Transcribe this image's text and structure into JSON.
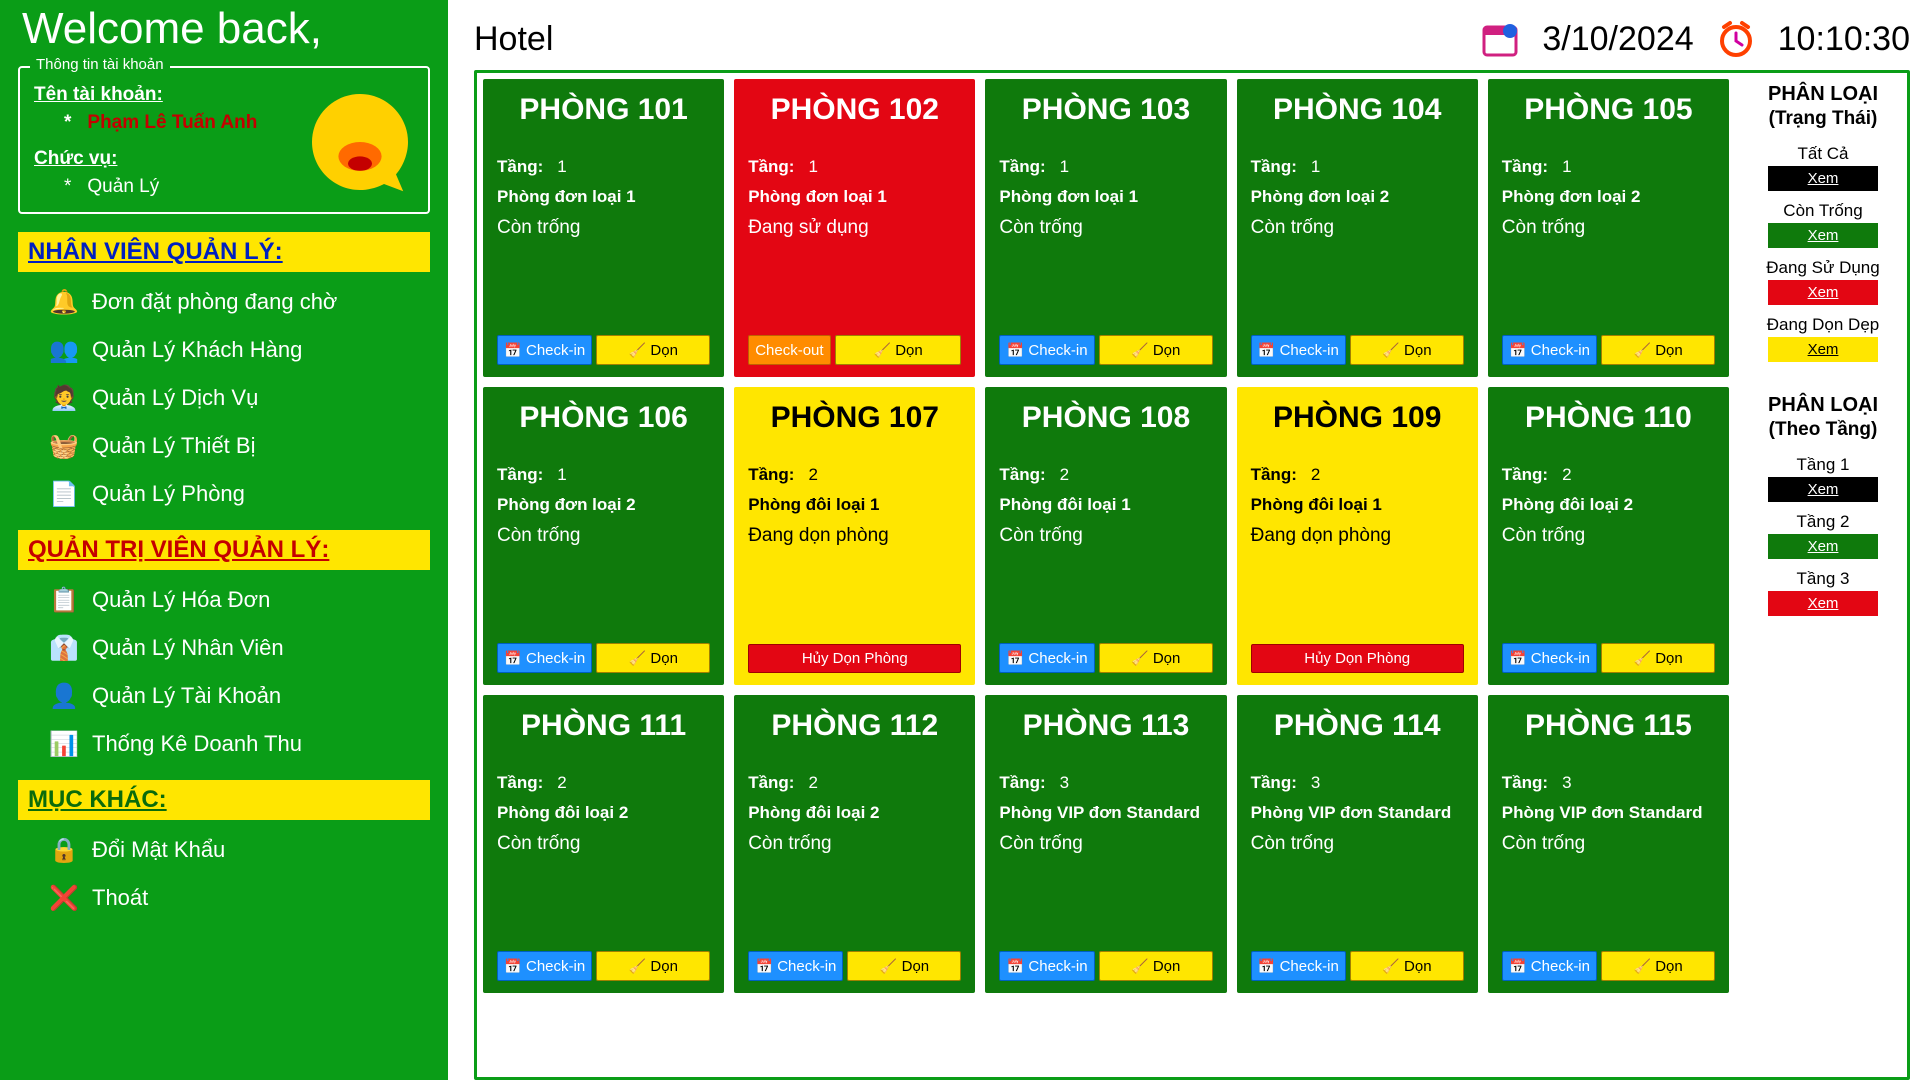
{
  "sidebar": {
    "welcome": "Welcome back,",
    "acct_legend": "Thông tin tài khoản",
    "acct_label": "Tên tài khoản:",
    "acct_name": "Phạm Lê Tuấn Anh",
    "role_label": "Chức vụ:",
    "role_value": "Quản Lý",
    "sections": [
      {
        "title": "NHÂN VIÊN QUẢN LÝ:",
        "color": "blue",
        "items": [
          {
            "icon": "🔔",
            "label": "Đơn đặt phòng đang chờ"
          },
          {
            "icon": "👥",
            "label": "Quản Lý Khách Hàng"
          },
          {
            "icon": "🧑‍💼",
            "label": "Quản Lý Dịch Vụ"
          },
          {
            "icon": "🧺",
            "label": "Quản Lý Thiết Bị"
          },
          {
            "icon": "📄",
            "label": "Quản Lý Phòng"
          }
        ]
      },
      {
        "title": "QUẢN TRỊ VIÊN QUẢN LÝ:",
        "color": "red",
        "items": [
          {
            "icon": "📋",
            "label": "Quản Lý Hóa Đơn"
          },
          {
            "icon": "👔",
            "label": "Quản Lý Nhân Viên"
          },
          {
            "icon": "👤",
            "label": "Quản Lý Tài Khoản"
          },
          {
            "icon": "📊",
            "label": "Thống Kê Doanh Thu"
          }
        ]
      },
      {
        "title": "MỤC KHÁC:",
        "color": "green",
        "items": [
          {
            "icon": "🔒",
            "label": "Đổi Mật Khẩu"
          },
          {
            "icon": "❌",
            "label": "Thoát"
          }
        ]
      }
    ]
  },
  "topbar": {
    "title": "Hotel",
    "date": "3/10/2024",
    "time": "10:10:30"
  },
  "buttons": {
    "checkin": "Check-in",
    "checkout": "Check-out",
    "clean": "Dọn",
    "cancel_clean": "Hủy Dọn Phòng"
  },
  "rooms": [
    {
      "name": "PHÒNG 101",
      "floor_label": "Tầng:",
      "floor": "1",
      "type": "Phòng đơn loại 1",
      "status": "Còn trống",
      "state": "avail"
    },
    {
      "name": "PHÒNG 102",
      "floor_label": "Tầng:",
      "floor": "1",
      "type": "Phòng đơn loại 1",
      "status": "Đang sử dụng",
      "state": "busy"
    },
    {
      "name": "PHÒNG 103",
      "floor_label": "Tầng:",
      "floor": "1",
      "type": "Phòng đơn loại 1",
      "status": "Còn trống",
      "state": "avail"
    },
    {
      "name": "PHÒNG 104",
      "floor_label": "Tầng:",
      "floor": "1",
      "type": "Phòng đơn loại 2",
      "status": "Còn trống",
      "state": "avail"
    },
    {
      "name": "PHÒNG 105",
      "floor_label": "Tầng:",
      "floor": "1",
      "type": "Phòng đơn loại 2",
      "status": "Còn trống",
      "state": "avail"
    },
    {
      "name": "PHÒNG 106",
      "floor_label": "Tầng:",
      "floor": "1",
      "type": "Phòng đơn loại 2",
      "status": "Còn trống",
      "state": "avail"
    },
    {
      "name": "PHÒNG 107",
      "floor_label": "Tầng:",
      "floor": "2",
      "type": "Phòng đôi loại 1",
      "status": "Đang dọn phòng",
      "state": "clean"
    },
    {
      "name": "PHÒNG 108",
      "floor_label": "Tầng:",
      "floor": "2",
      "type": "Phòng đôi loại 1",
      "status": "Còn trống",
      "state": "avail"
    },
    {
      "name": "PHÒNG 109",
      "floor_label": "Tầng:",
      "floor": "2",
      "type": "Phòng đôi loại 1",
      "status": "Đang dọn phòng",
      "state": "clean"
    },
    {
      "name": "PHÒNG 110",
      "floor_label": "Tầng:",
      "floor": "2",
      "type": "Phòng đôi loại 2",
      "status": "Còn trống",
      "state": "avail"
    },
    {
      "name": "PHÒNG 111",
      "floor_label": "Tầng:",
      "floor": "2",
      "type": "Phòng đôi loại 2",
      "status": "Còn trống",
      "state": "avail"
    },
    {
      "name": "PHÒNG 112",
      "floor_label": "Tầng:",
      "floor": "2",
      "type": "Phòng đôi loại 2",
      "status": "Còn trống",
      "state": "avail"
    },
    {
      "name": "PHÒNG 113",
      "floor_label": "Tầng:",
      "floor": "3",
      "type": "Phòng VIP đơn Standard",
      "status": "Còn trống",
      "state": "avail"
    },
    {
      "name": "PHÒNG 114",
      "floor_label": "Tầng:",
      "floor": "3",
      "type": "Phòng VIP đơn Standard",
      "status": "Còn trống",
      "state": "avail"
    },
    {
      "name": "PHÒNG 115",
      "floor_label": "Tầng:",
      "floor": "3",
      "type": "Phòng VIP đơn Standard",
      "status": "Còn trống",
      "state": "avail"
    }
  ],
  "filters": {
    "title1": "PHÂN LOẠI",
    "sub1": "(Trạng Thái)",
    "status_items": [
      {
        "label": "Tất Cả",
        "btn": "Xem",
        "cls": "black"
      },
      {
        "label": "Còn Trống",
        "btn": "Xem",
        "cls": "green"
      },
      {
        "label": "Đang Sử Dụng",
        "btn": "Xem",
        "cls": "red"
      },
      {
        "label": "Đang Dọn Dẹp",
        "btn": "Xem",
        "cls": "yellow"
      }
    ],
    "title2": "PHÂN LOẠI",
    "sub2": "(Theo Tầng)",
    "floor_items": [
      {
        "label": "Tầng 1",
        "btn": "Xem",
        "cls": "black"
      },
      {
        "label": "Tầng 2",
        "btn": "Xem",
        "cls": "green"
      },
      {
        "label": "Tầng 3",
        "btn": "Xem",
        "cls": "red"
      }
    ]
  }
}
